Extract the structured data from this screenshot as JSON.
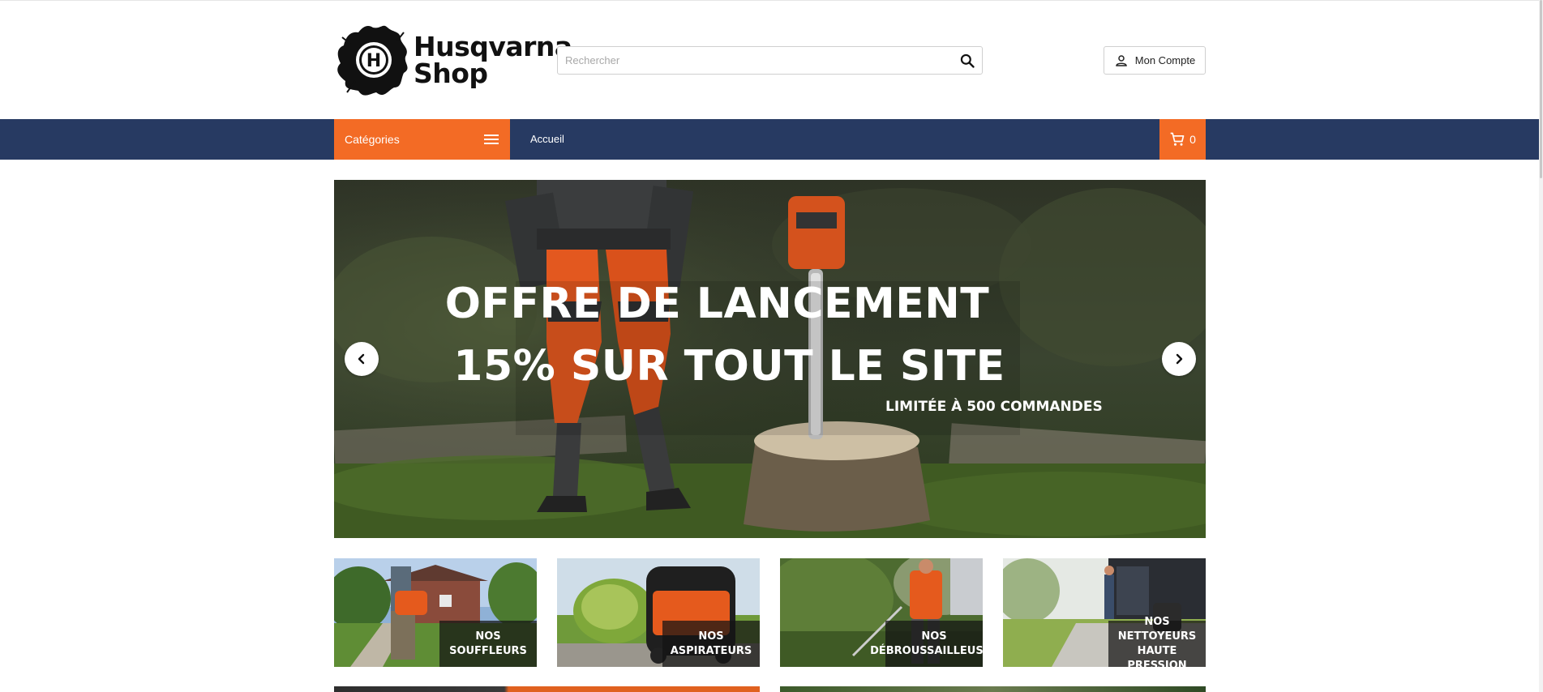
{
  "brand": {
    "line1": "Husqvarna",
    "line2": "Shop",
    "logo_letter": "H"
  },
  "search": {
    "placeholder": "Rechercher",
    "value": "",
    "icon": "search-icon"
  },
  "account": {
    "label": "Mon Compte",
    "icon": "user-icon"
  },
  "nav": {
    "categories_label": "Catégories",
    "categories_icon": "menu-icon",
    "home_label": "Accueil",
    "cart_count": "0",
    "cart_icon": "cart-icon"
  },
  "hero": {
    "line1": "OFFRE DE LANCEMENT",
    "line2": "15% SUR TOUT LE SITE",
    "subline": "LIMITÉE À 500 COMMANDES",
    "prev_icon": "chevron-left-icon",
    "next_icon": "chevron-right-icon"
  },
  "categories": [
    {
      "line1": "NOS",
      "line2": "SOUFFLEURS"
    },
    {
      "line1": "NOS",
      "line2": "ASPIRATEURS"
    },
    {
      "line1": "NOS",
      "line2": "DÉBROUSSAILLEUSES"
    },
    {
      "line1": "NOS NETTOYEURS",
      "line2": "HAUTE PRESSION"
    }
  ],
  "colors": {
    "accent": "#f36b25",
    "nav_background": "#273a62",
    "text": "#111111"
  }
}
